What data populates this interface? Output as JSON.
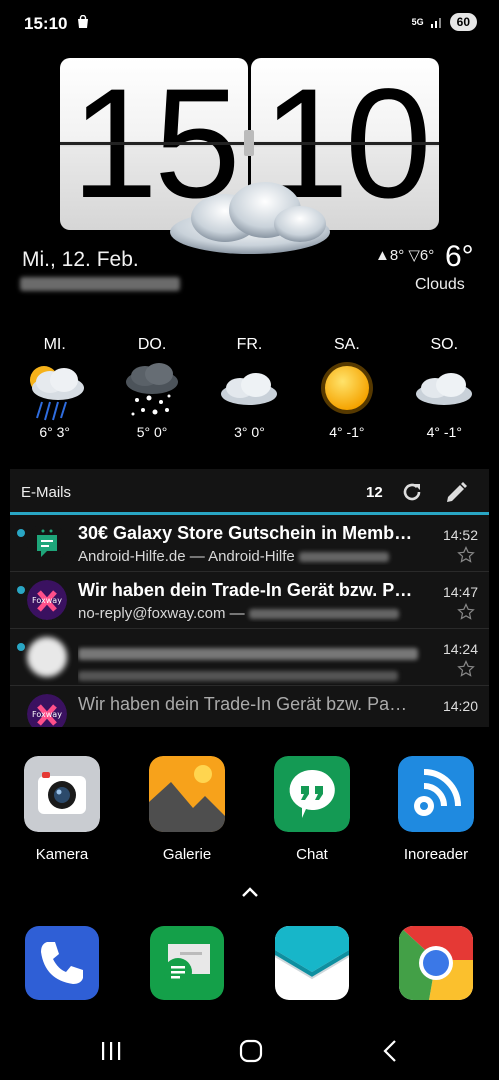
{
  "status_bar": {
    "time": "15:10",
    "network": "5G",
    "battery": "60"
  },
  "clock": {
    "hours": "15",
    "minutes": "10"
  },
  "weather": {
    "date": "Mi., 12. Feb.",
    "high": "▲8°",
    "low": "▽6°",
    "current": "6°",
    "condition": "Clouds",
    "forecast": [
      {
        "day": "MI.",
        "temps": "6°  3°",
        "icon": "rain-icon"
      },
      {
        "day": "DO.",
        "temps": "5°  0°",
        "icon": "snow-icon"
      },
      {
        "day": "FR.",
        "temps": "3°  0°",
        "icon": "cloud-icon"
      },
      {
        "day": "SA.",
        "temps": "4°  -1°",
        "icon": "sun-icon"
      },
      {
        "day": "SO.",
        "temps": "4°  -1°",
        "icon": "cloud-icon"
      }
    ]
  },
  "email": {
    "title": "E-Mails",
    "count": "12",
    "items": [
      {
        "subject": "30€ Galaxy Store Gutschein in Memb…",
        "sender": "Android-Hilfe.de — Android-Hilfe",
        "time": "14:52",
        "unread": true
      },
      {
        "subject": "Wir haben dein Trade-In Gerät bzw. P…",
        "sender": "no-reply@foxway.com —",
        "time": "14:47",
        "unread": true
      },
      {
        "subject": "",
        "sender": "",
        "time": "14:24",
        "unread": true
      },
      {
        "subject": "Wir haben dein Trade-In Gerät bzw. Pa…",
        "sender": "",
        "time": "14:20",
        "unread": false
      }
    ]
  },
  "apps": [
    {
      "label": "Kamera",
      "icon": "camera-icon"
    },
    {
      "label": "Galerie",
      "icon": "gallery-icon"
    },
    {
      "label": "Chat",
      "icon": "chat-icon"
    },
    {
      "label": "Inoreader",
      "icon": "rss-icon"
    }
  ],
  "dock": [
    {
      "icon": "phone-icon"
    },
    {
      "icon": "messages-icon"
    },
    {
      "icon": "email-app-icon"
    },
    {
      "icon": "chrome-icon"
    }
  ],
  "colors": {
    "accent": "#29a6c4",
    "background": "#000000"
  }
}
